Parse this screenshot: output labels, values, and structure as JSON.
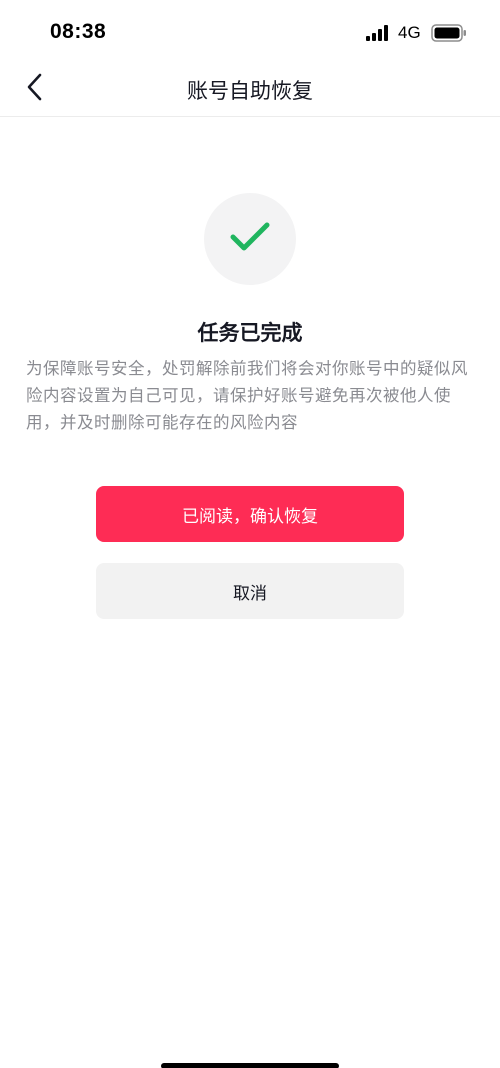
{
  "status_bar": {
    "time": "08:38",
    "network": "4G",
    "icons": [
      "signal-icon",
      "battery-icon"
    ]
  },
  "nav": {
    "title": "账号自助恢复",
    "back_icon": "chevron-left-icon"
  },
  "result": {
    "icon": "checkmark-icon",
    "icon_color": "#20b55f",
    "title": "任务已完成",
    "description": "为保障账号安全，处罚解除前我们将会对你账号中的疑似风险内容设置为自己可见，请保护好账号避免再次被他人使用，并及时删除可能存在的风险内容"
  },
  "actions": {
    "confirm_label": "已阅读，确认恢复",
    "cancel_label": "取消"
  },
  "colors": {
    "accent": "#fe2c55",
    "secondary_button": "#f2f2f2",
    "description_text": "#8a8b91"
  }
}
